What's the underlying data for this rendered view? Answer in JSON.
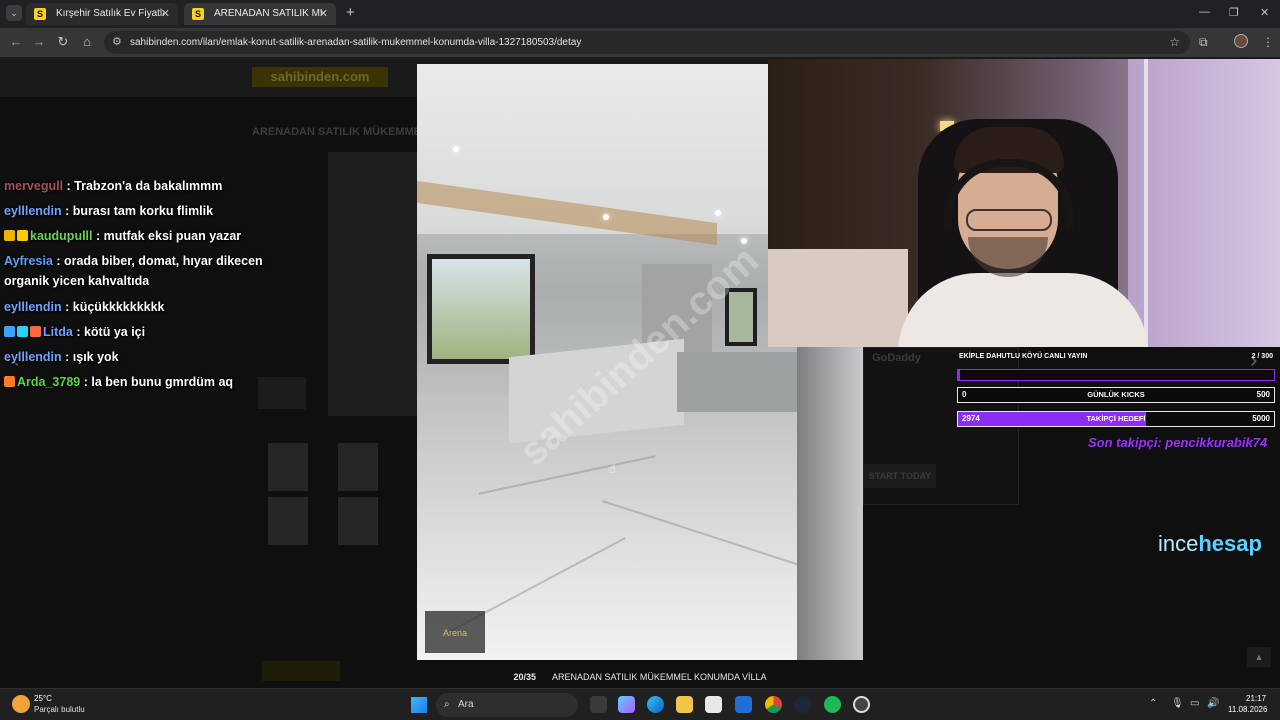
{
  "browser": {
    "tabs": [
      {
        "favicon": "S",
        "title": "Kırşehir Satılık Ev Fiyatları sahibin"
      },
      {
        "favicon": "S",
        "title": "ARENADAN SATILIK MÜKEMMEL"
      }
    ],
    "url": "sahibinden.com/ilan/emlak-konut-satilik-arenadan-satilik-mukemmel-konumda-villa-1327180503/detay",
    "icons": {
      "back": "arrow-left-icon",
      "forward": "arrow-right-icon",
      "reload": "reload-icon",
      "home": "home-icon",
      "bookmark": "star-icon",
      "extensions": "puzzle-icon",
      "menu": "kebab-menu-icon"
    }
  },
  "page": {
    "logo": "sahibinden.com",
    "listing_title": "ARENADAN SATILIK MÜKEMMEL",
    "lightbox": {
      "counter": "20/35",
      "caption": "ARENADAN SATILIK MÜKEMMEL KONUMDA VİLLA",
      "watermark": "sahibinden.com",
      "agency": "Arena"
    }
  },
  "chat": [
    {
      "user": "mervegull",
      "user_color": "#a3525a",
      "text": " : Trabzon'a da bakalımmm",
      "badges": []
    },
    {
      "user": "eylllendin",
      "user_color": "#6fa3ff",
      "text": " : burası tam korku flimlik",
      "badges": []
    },
    {
      "user": "kaudupulll",
      "user_color": "#6bd44f",
      "text": " : mutfak eksi puan yazar",
      "badges": [
        "#f0b400",
        "#ffcc00"
      ]
    },
    {
      "user": "Ayfresia",
      "user_color": "#58a0ff",
      "text": " : orada biber, domat, hıyar dikecen organik yicen kahvaltıda",
      "badges": []
    },
    {
      "user": "eylllendin",
      "user_color": "#6fa3ff",
      "text": " : küçükkkkkkkkk",
      "badges": []
    },
    {
      "user": "Litda",
      "user_color": "#6fa3ff",
      "text": " : kötü ya içi",
      "badges": [
        "#3aa3ff",
        "#2ad0ff",
        "#ff6a3c"
      ]
    },
    {
      "user": "eylllendin",
      "user_color": "#6fa3ff",
      "text": " : ışık yok",
      "badges": []
    },
    {
      "user": "Arda_3789",
      "user_color": "#5ed34a",
      "text": " : la ben bunu gmrdüm aq",
      "badges": [
        "#ff7a2a"
      ]
    }
  ],
  "overlay": {
    "goal_title": "EKİPLE DAHUTLU KÖYÜ CANLI YAYIN",
    "goal_count": "2 / 300",
    "goal_progress": 0.0067,
    "kicks": {
      "left": "0",
      "label": "GÜNLÜK KICKS",
      "right": "500",
      "progress": 0
    },
    "followers": {
      "left": "2974",
      "label": "TAKİPÇİ HEDEFİ",
      "right": "5000",
      "progress": 0.5948
    },
    "last_follower": "Son takipçi: pencikkurabik74",
    "sponsor_light": "ince",
    "sponsor_bold": "hesap",
    "ad_brand": "GoDaddy",
    "ad_cta": "START TODAY"
  },
  "taskbar": {
    "temperature": "25°C",
    "weather": "Parçalı bulutlu",
    "search_placeholder": "Ara",
    "time": "21:17",
    "date": "11.08.2026",
    "apps": [
      "windows-start-icon",
      "search-icon",
      "task-view-icon",
      "copilot-icon",
      "edge-icon",
      "file-explorer-icon",
      "store-icon",
      "mail-icon",
      "chrome-icon",
      "steam-icon",
      "spotify-icon",
      "obs-icon"
    ]
  }
}
